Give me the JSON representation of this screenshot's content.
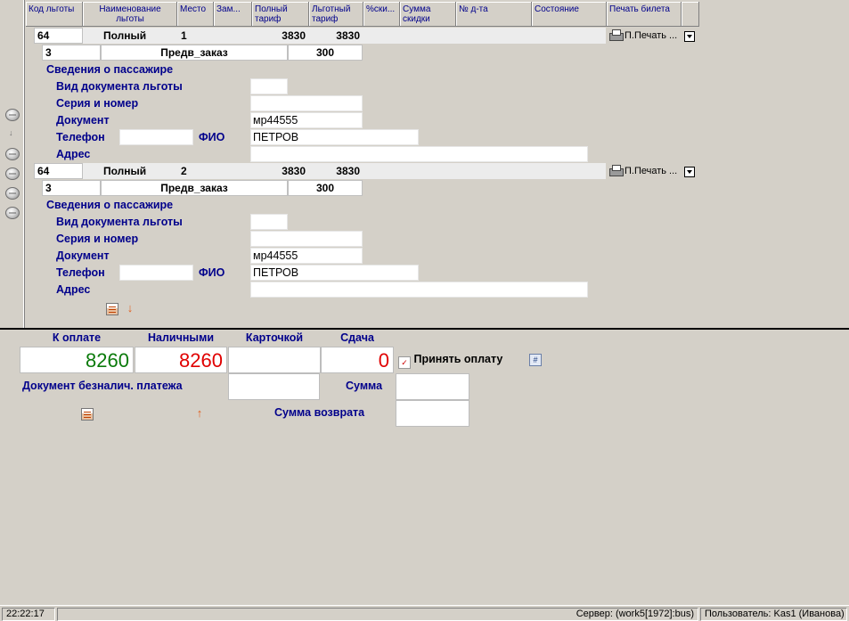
{
  "grid": {
    "columns": [
      "Код льготы",
      "Наименование льготы",
      "Место",
      "Зам...",
      "Полный тариф",
      "Льготный тариф",
      "%ски...",
      "Сумма скидки",
      "№ д-та",
      "Состояние",
      "Печать билета"
    ]
  },
  "tickets": [
    {
      "code": "64",
      "benefit": "Полный",
      "seat": "1",
      "full_tariff": "3830",
      "benefit_tariff": "3830",
      "print": "П.Печать ...",
      "order_num": "3",
      "order_type": "Предв_заказ",
      "order_amount": "300",
      "passenger": {
        "section_title": "Сведения о пассажире",
        "labels": {
          "doc_type": "Вид документа льготы",
          "series": "Серия и номер",
          "document": "Документ",
          "phone": "Телефон",
          "fio": "ФИО",
          "address": "Адрес"
        },
        "document": "мр44555",
        "fio": "ПЕТРОВ",
        "phone": "",
        "address": ""
      }
    },
    {
      "code": "64",
      "benefit": "Полный",
      "seat": "2",
      "full_tariff": "3830",
      "benefit_tariff": "3830",
      "print": "П.Печать ...",
      "order_num": "3",
      "order_type": "Предв_заказ",
      "order_amount": "300",
      "passenger": {
        "section_title": "Сведения о пассажире",
        "labels": {
          "doc_type": "Вид документа льготы",
          "series": "Серия и номер",
          "document": "Документ",
          "phone": "Телефон",
          "fio": "ФИО",
          "address": "Адрес"
        },
        "document": "мр44555",
        "fio": "ПЕТРОВ",
        "phone": "",
        "address": ""
      }
    }
  ],
  "payment": {
    "headers": {
      "to_pay": "К оплате",
      "cash": "Наличными",
      "card": "Карточкой",
      "change": "Сдача"
    },
    "to_pay": "8260",
    "cash": "8260",
    "card": "",
    "change": "0",
    "accept_label": "Принять оплату",
    "noncash_doc_label": "Документ безналич. платежа",
    "sum_label": "Сумма",
    "refund_label": "Сумма возврата",
    "colors": {
      "to_pay": "#0a7a0a",
      "cash": "#e00000",
      "change": "#e00000"
    }
  },
  "statusbar": {
    "time": "22:22:17",
    "server": "Сервер: (work5[1972]:bus)",
    "user": "Пользователь: Kas1 (Иванова)"
  }
}
